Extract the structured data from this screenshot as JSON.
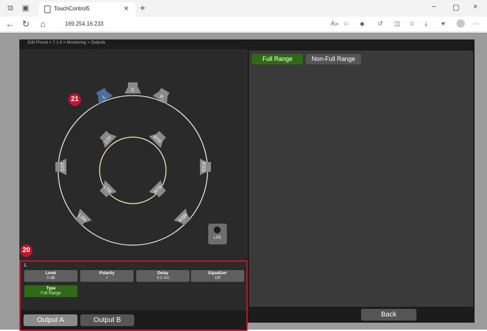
{
  "browser": {
    "tab_title": "TouchControl5",
    "url": "169.254.16.233",
    "new_tab": "+",
    "tab_close": "×",
    "win_minimize": "−",
    "win_maximize": "▢",
    "win_close": "×",
    "read_aloud": "A»",
    "more": "···"
  },
  "app": {
    "breadcrumb": "Edit Preset > 7.1.4 > Monitoring > Outputs",
    "selected_speaker": "L",
    "speakers": {
      "L": "L",
      "C": "C",
      "R": "R",
      "SST": "SST",
      "RSS": "RSS",
      "LTF": "LTF",
      "RTF": "RTF",
      "LTR": "LTR",
      "RTR": "RTR",
      "LSR": "LSR",
      "RSR": "RSR",
      "LFE": "LFE"
    },
    "callouts": {
      "c21": "21",
      "c20": "20"
    },
    "params": {
      "level": {
        "title": "Level",
        "value": "0 dB"
      },
      "polarity": {
        "title": "Polarity",
        "value": "+"
      },
      "delay": {
        "title": "Delay",
        "value": "0.0 ms"
      },
      "equalizer": {
        "title": "Equalizer",
        "value": "Off"
      },
      "type": {
        "title": "Type",
        "value": "Full Range"
      }
    },
    "outputs": {
      "a": "Output A",
      "b": "Output B"
    },
    "right_tabs": {
      "full": "Full Range",
      "non_full": "Non-Full Range"
    },
    "back": "Back"
  },
  "colors": {
    "accent_green": "#2f6b14",
    "callout_red": "#c0152f",
    "selected_blue": "#4a6f9e",
    "speaker_gray": "#8a8a8a"
  },
  "icons": [
    "tab-actions-icon",
    "vertical-tabs-icon",
    "page-icon",
    "back-arrow-icon",
    "refresh-icon",
    "home-icon",
    "read-aloud-icon",
    "favorite-star-icon",
    "extension-icon",
    "refresh-site-icon",
    "split-screen-icon",
    "favorites-icon",
    "download-icon",
    "shield-icon",
    "profile-icon",
    "more-icon"
  ]
}
